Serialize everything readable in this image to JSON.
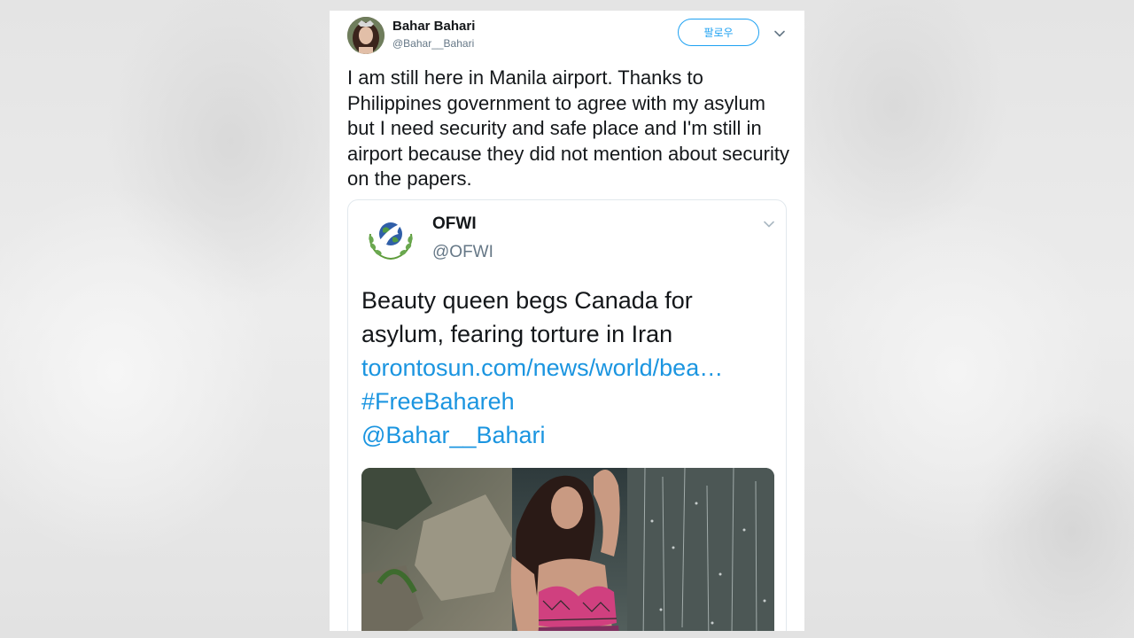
{
  "tweet": {
    "author_name": "Bahar Bahari",
    "author_handle": "@Bahar__Bahari",
    "follow_label": "팔로우",
    "text": "I am still here in Manila airport.  Thanks to Philippines government to agree with my asylum but I need security and safe place and I'm still in airport because they did not mention about security on the papers.",
    "menu_icon": "chevron-down-icon",
    "colors": {
      "accent": "#1da1f2",
      "link": "#1b95e0",
      "text": "#14171a",
      "secondary": "#657786"
    }
  },
  "quoted_tweet": {
    "author_name": "OFWI",
    "author_handle": "@OFWI",
    "logo_icon": "dove-globe-laurel-logo",
    "text_plain": "Beauty queen begs Canada for asylum, fearing torture in Iran",
    "link_url_text": "torontosun.com/news/world/bea…",
    "hashtag": "#FreeBahareh",
    "mention": "@Bahar__Bahari",
    "menu_icon": "chevron-down-icon"
  }
}
